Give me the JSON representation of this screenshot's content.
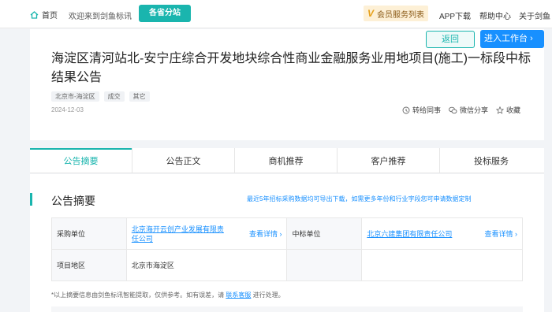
{
  "topbar": {
    "home_label": "首页",
    "welcome": "欢迎来到剑鱼标讯",
    "branch_button": "各省分站",
    "vip_label": "会员服务列表",
    "app_download": "APP下载",
    "help_center": "帮助中心",
    "about": "关于剑鱼"
  },
  "header": {
    "back_button": "返回",
    "workbench_button": "进入工作台",
    "title": "海淀区清河站北-安宁庄综合开发地块综合性商业金融服务业用地项目(施工)一标段中标结果公告",
    "tags": [
      "北京市-海淀区",
      "成交",
      "其它"
    ],
    "date": "2024-12-03",
    "actions": {
      "forward": "转给同事",
      "wechat_share": "微信分享",
      "favorite": "收藏"
    }
  },
  "tabs": [
    "公告摘要",
    "公告正文",
    "商机推荐",
    "客户推荐",
    "投标服务"
  ],
  "summary": {
    "title": "公告摘要",
    "note": "最近5年招标采购数据均可导出下载，如需更多年份和行业字段您可申请数据定制",
    "rows": [
      {
        "label1": "采购单位",
        "value1": "北京海开云创产业发展有限责任公司",
        "detail1": "查看详情",
        "label2": "中标单位",
        "value2": "北京六建集团有限责任公司",
        "detail2": "查看详情"
      },
      {
        "label1": "项目地区",
        "value1": "北京市海淀区",
        "label2": "",
        "value2": ""
      }
    ],
    "footnote_prefix": "*以上摘要信息由剑鱼标讯智能提取，仅供参考。如有误差，请",
    "footnote_link": "联系客服",
    "footnote_suffix": "进行处理。"
  },
  "colors": {
    "accent": "#1ab5ae",
    "link": "#1890ff",
    "primary_button": "#1890ff"
  }
}
